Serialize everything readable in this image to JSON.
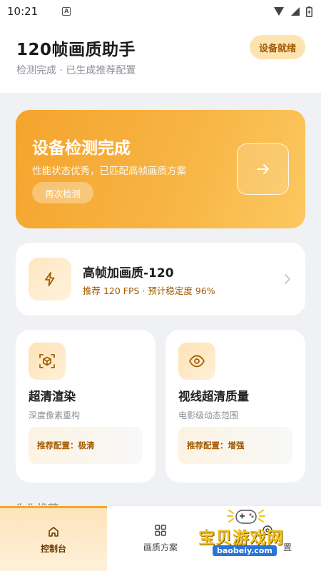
{
  "status_bar": {
    "time": "10:21",
    "notif_letter": "A"
  },
  "header": {
    "title": "120帧画质助手",
    "subtitle": "检测完成 · 已生成推荐配置",
    "badge": "设备就绪"
  },
  "hero": {
    "title": "设备检测完成",
    "description": "性能状态优秀，已匹配高帧画质方案",
    "button": "再次检测"
  },
  "preset": {
    "title": "高帧加画质-120",
    "meta": "推荐 120 FPS · 预计稳定度 96%"
  },
  "features": [
    {
      "title": "超清渲染",
      "desc": "深度像素重构",
      "config": "推荐配置：极清",
      "icon": "cube-scan-icon"
    },
    {
      "title": "视线超清质量",
      "desc": "电影级动态范围",
      "config": "推荐配置：增强",
      "icon": "eye-icon"
    }
  ],
  "section_peek": "为你推荐",
  "nav": [
    {
      "label": "控制台",
      "icon": "home-icon",
      "active": true
    },
    {
      "label": "画质方案",
      "icon": "grid-icon",
      "active": false
    },
    {
      "label": "置",
      "icon": "settings-icon",
      "active": false
    }
  ],
  "watermark": {
    "text": "宝贝游戏网",
    "url": "baobeiy.com"
  },
  "colors": {
    "accent": "#f4a72b",
    "accent_dark": "#a25a00",
    "background": "#eff1f4"
  }
}
